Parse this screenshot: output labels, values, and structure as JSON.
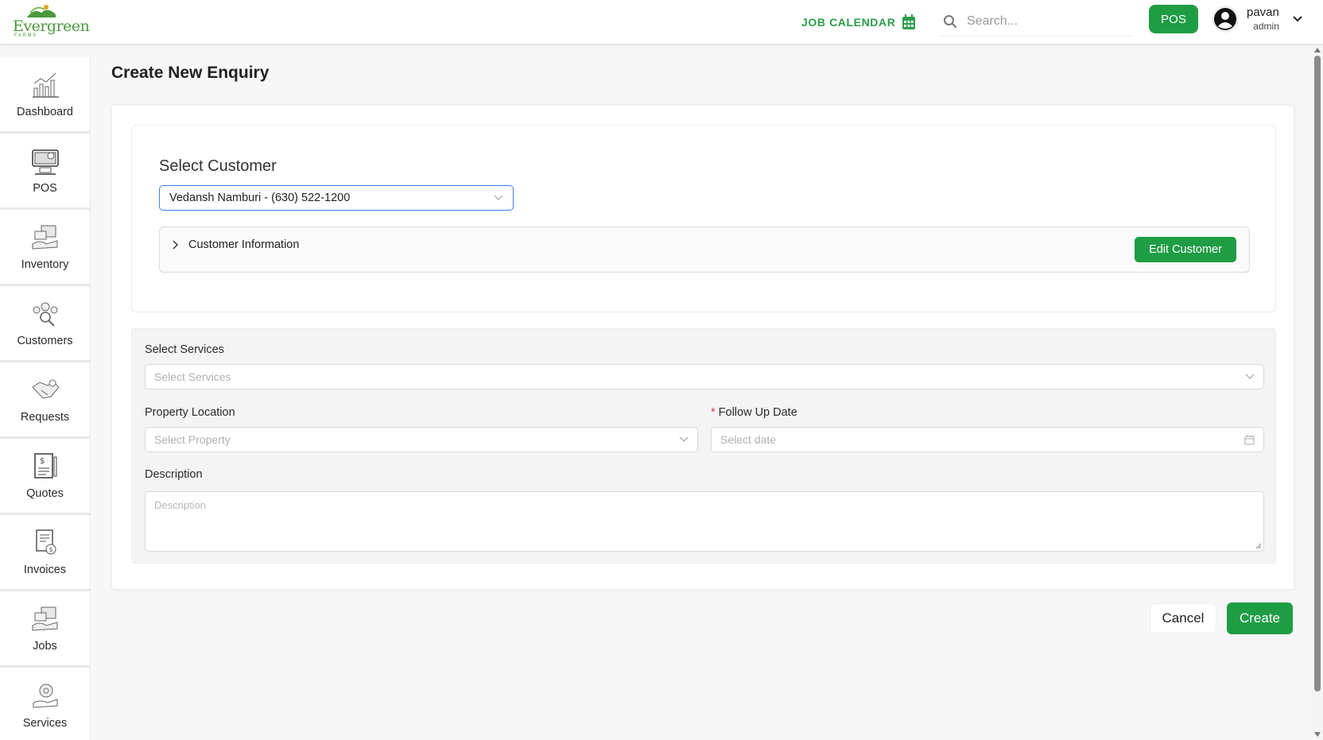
{
  "brand": {
    "name": "Evergreen",
    "sub": "FARMS",
    "accent": "#1f9d45"
  },
  "header": {
    "job_calendar_label": "JOB CALENDAR",
    "search_placeholder": "Search...",
    "pos_label": "POS",
    "user": {
      "name": "pavan",
      "role": "admin"
    }
  },
  "sidebar": {
    "items": [
      {
        "label": "Dashboard",
        "icon": "dashboard-chart-icon"
      },
      {
        "label": "POS",
        "icon": "pos-terminal-icon"
      },
      {
        "label": "Inventory",
        "icon": "inventory-icon"
      },
      {
        "label": "Customers",
        "icon": "customers-icon"
      },
      {
        "label": "Requests",
        "icon": "requests-handshake-icon"
      },
      {
        "label": "Quotes",
        "icon": "quotes-document-icon"
      },
      {
        "label": "Invoices",
        "icon": "invoice-icon"
      },
      {
        "label": "Jobs",
        "icon": "jobs-icon"
      },
      {
        "label": "Services",
        "icon": "services-icon"
      }
    ]
  },
  "page": {
    "title": "Create New Enquiry"
  },
  "customer": {
    "section_label": "Select Customer",
    "selected": "Vedansh Namburi - (630) 522-1200",
    "info_label": "Customer Information",
    "edit_label": "Edit Customer"
  },
  "form": {
    "services_label": "Select Services",
    "services_placeholder": "Select Services",
    "property_label": "Property Location",
    "property_placeholder": "Select Property",
    "follow_up_label": "Follow Up Date",
    "follow_up_placeholder": "Select date",
    "description_label": "Description",
    "description_placeholder": "Description",
    "required_mark": "*"
  },
  "actions": {
    "cancel_label": "Cancel",
    "create_label": "Create"
  }
}
